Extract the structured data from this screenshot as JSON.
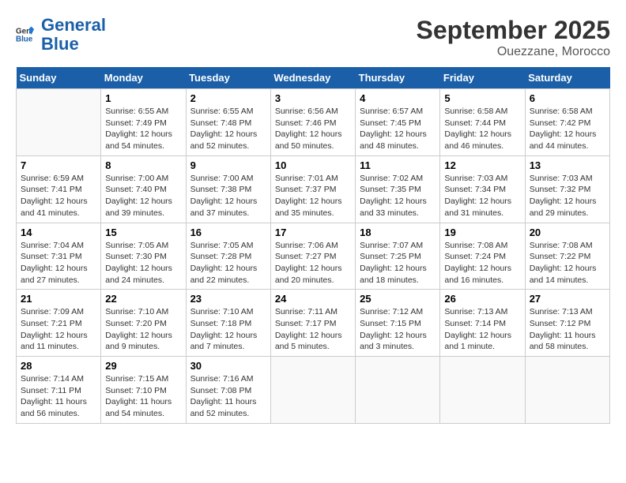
{
  "header": {
    "logo_line1": "General",
    "logo_line2": "Blue",
    "month": "September 2025",
    "location": "Ouezzane, Morocco"
  },
  "weekdays": [
    "Sunday",
    "Monday",
    "Tuesday",
    "Wednesday",
    "Thursday",
    "Friday",
    "Saturday"
  ],
  "weeks": [
    [
      {
        "day": "",
        "info": ""
      },
      {
        "day": "1",
        "info": "Sunrise: 6:55 AM\nSunset: 7:49 PM\nDaylight: 12 hours\nand 54 minutes."
      },
      {
        "day": "2",
        "info": "Sunrise: 6:55 AM\nSunset: 7:48 PM\nDaylight: 12 hours\nand 52 minutes."
      },
      {
        "day": "3",
        "info": "Sunrise: 6:56 AM\nSunset: 7:46 PM\nDaylight: 12 hours\nand 50 minutes."
      },
      {
        "day": "4",
        "info": "Sunrise: 6:57 AM\nSunset: 7:45 PM\nDaylight: 12 hours\nand 48 minutes."
      },
      {
        "day": "5",
        "info": "Sunrise: 6:58 AM\nSunset: 7:44 PM\nDaylight: 12 hours\nand 46 minutes."
      },
      {
        "day": "6",
        "info": "Sunrise: 6:58 AM\nSunset: 7:42 PM\nDaylight: 12 hours\nand 44 minutes."
      }
    ],
    [
      {
        "day": "7",
        "info": "Sunrise: 6:59 AM\nSunset: 7:41 PM\nDaylight: 12 hours\nand 41 minutes."
      },
      {
        "day": "8",
        "info": "Sunrise: 7:00 AM\nSunset: 7:40 PM\nDaylight: 12 hours\nand 39 minutes."
      },
      {
        "day": "9",
        "info": "Sunrise: 7:00 AM\nSunset: 7:38 PM\nDaylight: 12 hours\nand 37 minutes."
      },
      {
        "day": "10",
        "info": "Sunrise: 7:01 AM\nSunset: 7:37 PM\nDaylight: 12 hours\nand 35 minutes."
      },
      {
        "day": "11",
        "info": "Sunrise: 7:02 AM\nSunset: 7:35 PM\nDaylight: 12 hours\nand 33 minutes."
      },
      {
        "day": "12",
        "info": "Sunrise: 7:03 AM\nSunset: 7:34 PM\nDaylight: 12 hours\nand 31 minutes."
      },
      {
        "day": "13",
        "info": "Sunrise: 7:03 AM\nSunset: 7:32 PM\nDaylight: 12 hours\nand 29 minutes."
      }
    ],
    [
      {
        "day": "14",
        "info": "Sunrise: 7:04 AM\nSunset: 7:31 PM\nDaylight: 12 hours\nand 27 minutes."
      },
      {
        "day": "15",
        "info": "Sunrise: 7:05 AM\nSunset: 7:30 PM\nDaylight: 12 hours\nand 24 minutes."
      },
      {
        "day": "16",
        "info": "Sunrise: 7:05 AM\nSunset: 7:28 PM\nDaylight: 12 hours\nand 22 minutes."
      },
      {
        "day": "17",
        "info": "Sunrise: 7:06 AM\nSunset: 7:27 PM\nDaylight: 12 hours\nand 20 minutes."
      },
      {
        "day": "18",
        "info": "Sunrise: 7:07 AM\nSunset: 7:25 PM\nDaylight: 12 hours\nand 18 minutes."
      },
      {
        "day": "19",
        "info": "Sunrise: 7:08 AM\nSunset: 7:24 PM\nDaylight: 12 hours\nand 16 minutes."
      },
      {
        "day": "20",
        "info": "Sunrise: 7:08 AM\nSunset: 7:22 PM\nDaylight: 12 hours\nand 14 minutes."
      }
    ],
    [
      {
        "day": "21",
        "info": "Sunrise: 7:09 AM\nSunset: 7:21 PM\nDaylight: 12 hours\nand 11 minutes."
      },
      {
        "day": "22",
        "info": "Sunrise: 7:10 AM\nSunset: 7:20 PM\nDaylight: 12 hours\nand 9 minutes."
      },
      {
        "day": "23",
        "info": "Sunrise: 7:10 AM\nSunset: 7:18 PM\nDaylight: 12 hours\nand 7 minutes."
      },
      {
        "day": "24",
        "info": "Sunrise: 7:11 AM\nSunset: 7:17 PM\nDaylight: 12 hours\nand 5 minutes."
      },
      {
        "day": "25",
        "info": "Sunrise: 7:12 AM\nSunset: 7:15 PM\nDaylight: 12 hours\nand 3 minutes."
      },
      {
        "day": "26",
        "info": "Sunrise: 7:13 AM\nSunset: 7:14 PM\nDaylight: 12 hours\nand 1 minute."
      },
      {
        "day": "27",
        "info": "Sunrise: 7:13 AM\nSunset: 7:12 PM\nDaylight: 11 hours\nand 58 minutes."
      }
    ],
    [
      {
        "day": "28",
        "info": "Sunrise: 7:14 AM\nSunset: 7:11 PM\nDaylight: 11 hours\nand 56 minutes."
      },
      {
        "day": "29",
        "info": "Sunrise: 7:15 AM\nSunset: 7:10 PM\nDaylight: 11 hours\nand 54 minutes."
      },
      {
        "day": "30",
        "info": "Sunrise: 7:16 AM\nSunset: 7:08 PM\nDaylight: 11 hours\nand 52 minutes."
      },
      {
        "day": "",
        "info": ""
      },
      {
        "day": "",
        "info": ""
      },
      {
        "day": "",
        "info": ""
      },
      {
        "day": "",
        "info": ""
      }
    ]
  ]
}
